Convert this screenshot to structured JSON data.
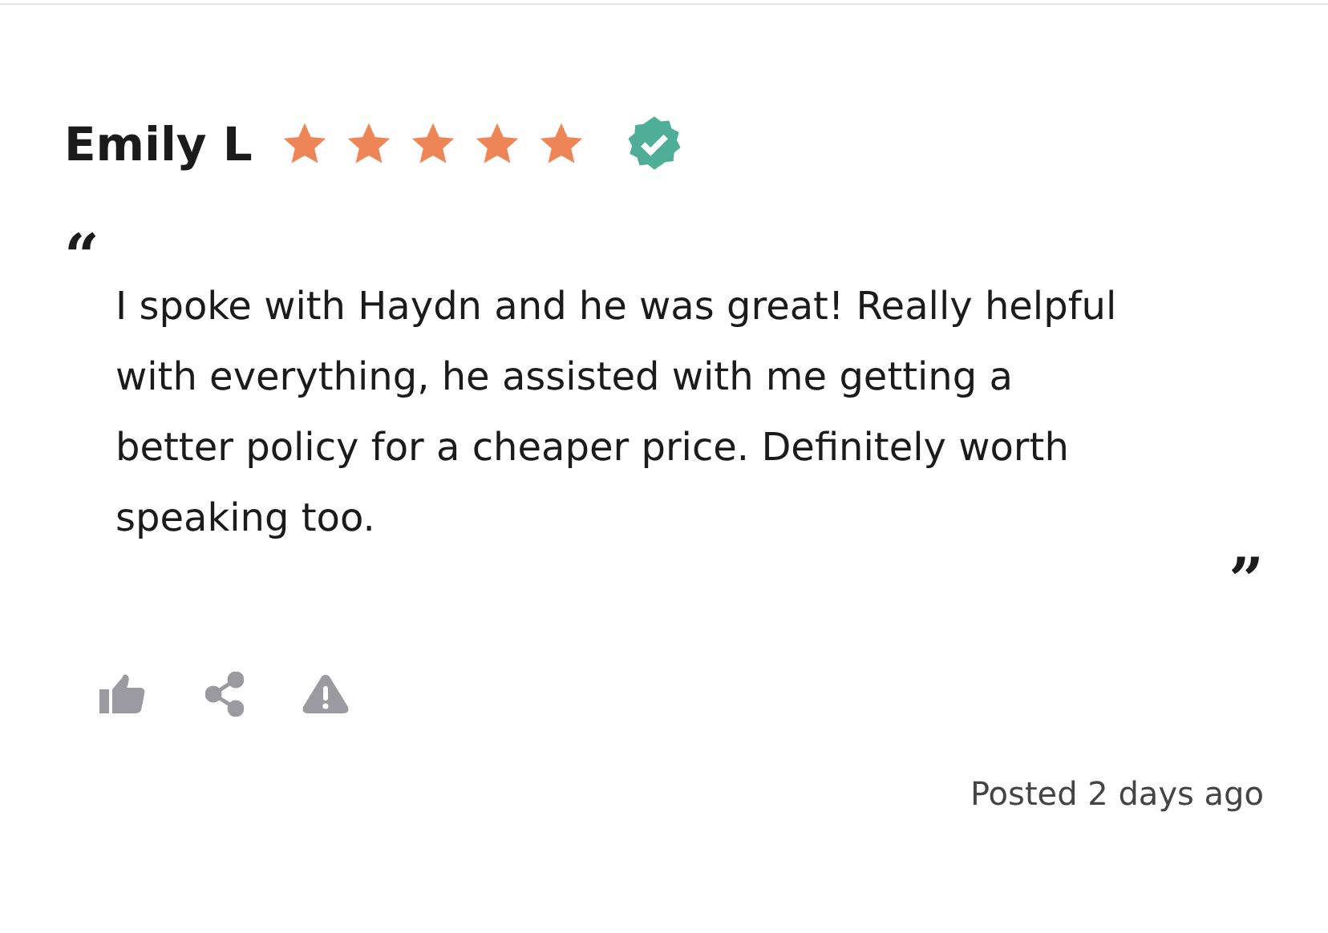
{
  "review": {
    "author": "Emily L",
    "stars": 5,
    "verified": true,
    "open_quote": "“",
    "text": "I spoke with Haydn and he was great! Really helpful with everything, he assisted with me getting a better policy for a cheaper price. Definitely worth speaking too.",
    "close_quote": "”",
    "actions": [
      {
        "kind": "like"
      },
      {
        "kind": "share"
      },
      {
        "kind": "report"
      }
    ],
    "posted": "Posted 2 days ago"
  }
}
